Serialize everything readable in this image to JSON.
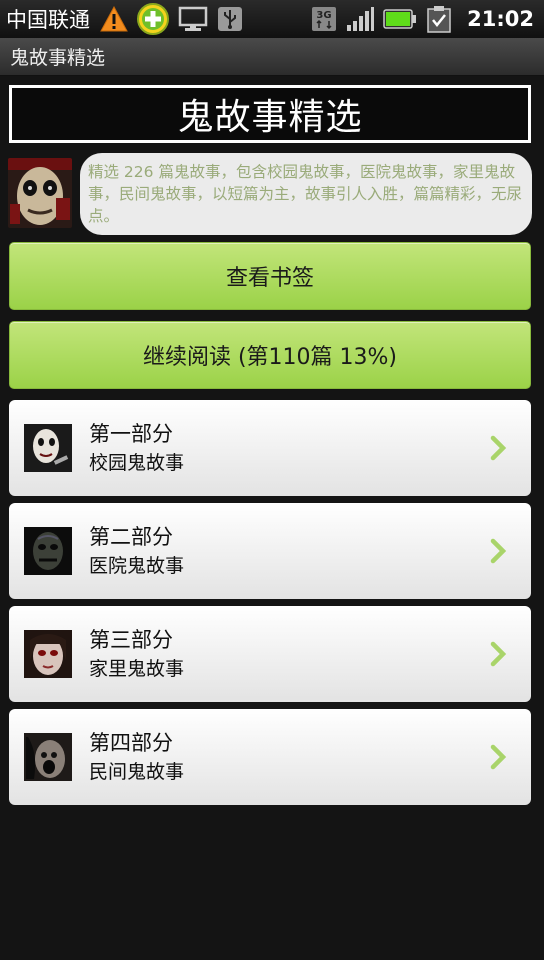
{
  "status_bar": {
    "carrier": "中国联通",
    "network": "3G",
    "time": "21:02",
    "icons": [
      "warning-icon",
      "app-plus-icon",
      "monitor-icon",
      "usb-icon",
      "3g-icon",
      "signal-icon",
      "battery-icon",
      "clipboard-check-icon"
    ]
  },
  "app": {
    "title": "鬼故事精选"
  },
  "header": {
    "title": "鬼故事精选"
  },
  "intro": {
    "text": "精选 226 篇鬼故事，包含校园鬼故事，医院鬼故事，家里鬼故事，民间鬼故事，以短篇为主，故事引人入胜，篇篇精彩，无尿点。"
  },
  "buttons": {
    "bookmark": "查看书签",
    "continue": "继续阅读 (第110篇 13%)"
  },
  "chapters": [
    {
      "title": "第一部分",
      "subtitle": "校园鬼故事"
    },
    {
      "title": "第二部分",
      "subtitle": "医院鬼故事"
    },
    {
      "title": "第三部分",
      "subtitle": "家里鬼故事"
    },
    {
      "title": "第四部分",
      "subtitle": "民间鬼故事"
    }
  ],
  "colors": {
    "button_green": "#9bd248",
    "intro_text": "#9aab7a",
    "chevron": "#a9d46a",
    "background": "#141414"
  }
}
